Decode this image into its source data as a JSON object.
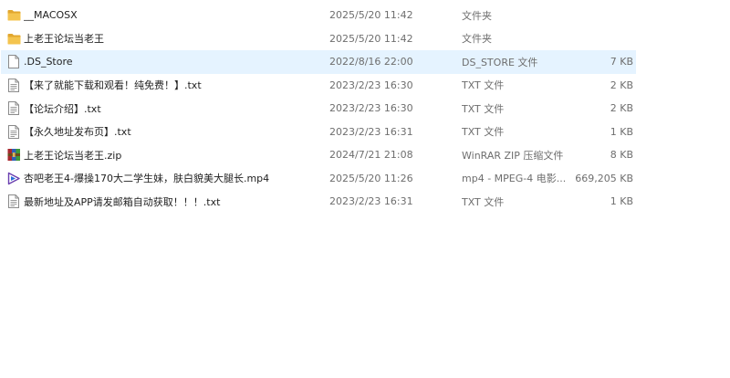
{
  "files": [
    {
      "name": "__MACOSX",
      "date": "2025/5/20 11:42",
      "type": "文件夹",
      "size": "",
      "icon": "folder-icon",
      "selected": false
    },
    {
      "name": "上老王论坛当老王",
      "date": "2025/5/20 11:42",
      "type": "文件夹",
      "size": "",
      "icon": "folder-icon",
      "selected": false
    },
    {
      "name": ".DS_Store",
      "date": "2022/8/16 22:00",
      "type": "DS_STORE 文件",
      "size": "7 KB",
      "icon": "file-icon",
      "selected": true
    },
    {
      "name": "【来了就能下载和观看！纯免费！】.txt",
      "date": "2023/2/23 16:30",
      "type": "TXT 文件",
      "size": "2 KB",
      "icon": "text-file-icon",
      "selected": false
    },
    {
      "name": "【论坛介绍】.txt",
      "date": "2023/2/23 16:30",
      "type": "TXT 文件",
      "size": "2 KB",
      "icon": "text-file-icon",
      "selected": false
    },
    {
      "name": "【永久地址发布页】.txt",
      "date": "2023/2/23 16:31",
      "type": "TXT 文件",
      "size": "1 KB",
      "icon": "text-file-icon",
      "selected": false
    },
    {
      "name": "上老王论坛当老王.zip",
      "date": "2024/7/21 21:08",
      "type": "WinRAR ZIP 压缩文件",
      "size": "8 KB",
      "icon": "winrar-archive-icon",
      "selected": false
    },
    {
      "name": "杏吧老王4-爆操170大二学生妹，肤白貌美大腿长.mp4",
      "date": "2025/5/20 11:26",
      "type": "mp4 - MPEG-4 电影...",
      "size": "669,205 KB",
      "icon": "video-file-icon",
      "selected": false
    },
    {
      "name": "最新地址及APP请发邮箱自动获取！！！.txt",
      "date": "2023/2/23 16:31",
      "type": "TXT 文件",
      "size": "1 KB",
      "icon": "text-file-icon",
      "selected": false
    }
  ],
  "colors": {
    "folder": "#f4c44e",
    "folder_dark": "#e2a72e",
    "selection": "#e5f3ff",
    "secondary_text": "#6e6e6e"
  }
}
